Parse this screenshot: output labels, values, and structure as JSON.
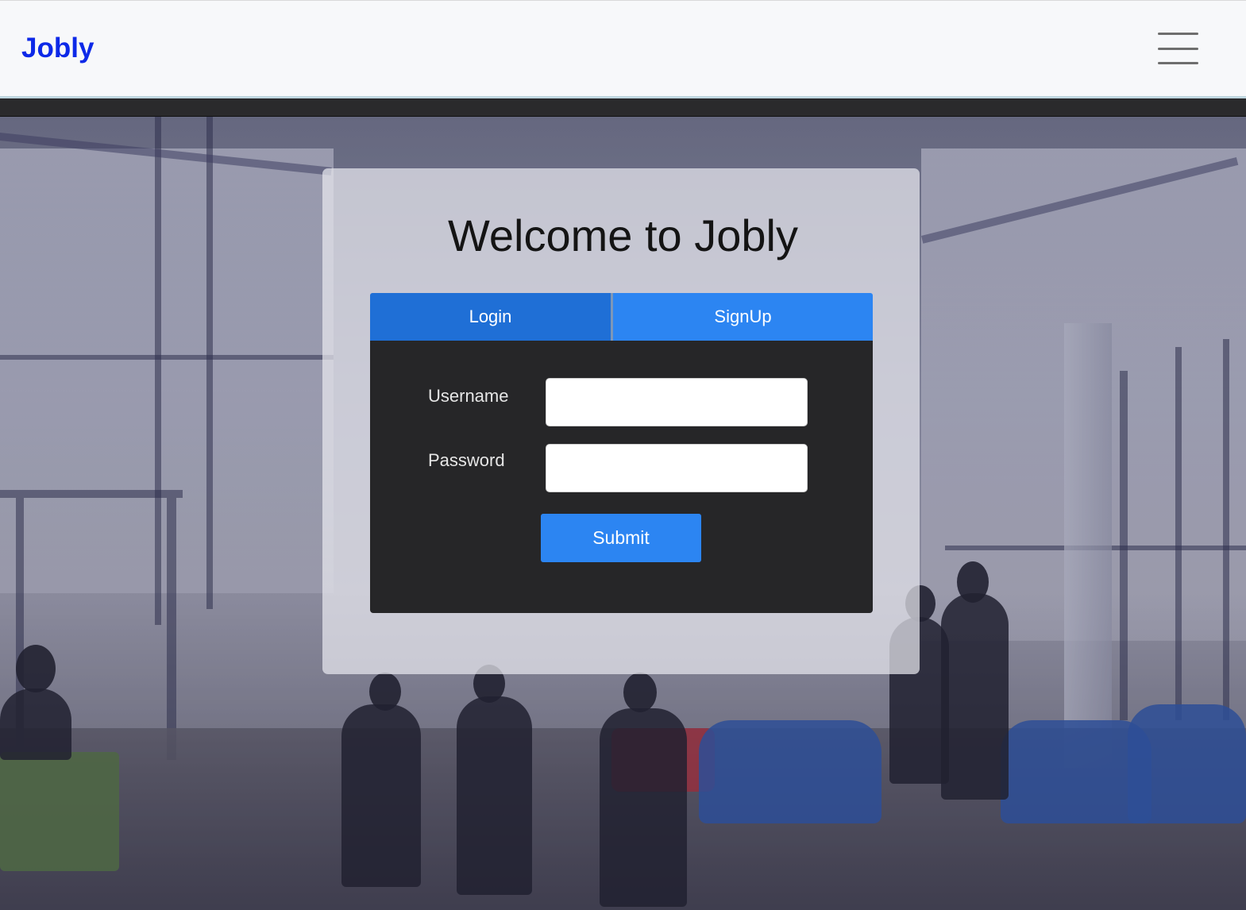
{
  "navbar": {
    "brand": "Jobly",
    "brand_color": "#0d29e8",
    "menu_icon": "hamburger-menu-icon"
  },
  "login_card": {
    "title": "Welcome to Jobly",
    "tabs": [
      {
        "label": "Login",
        "active": true
      },
      {
        "label": "SignUp",
        "active": false
      }
    ],
    "fields": {
      "username": {
        "label": "Username",
        "value": "",
        "placeholder": ""
      },
      "password": {
        "label": "Password",
        "value": "",
        "placeholder": ""
      }
    },
    "submit_label": "Submit",
    "accent_color": "#2c85f2",
    "active_tab_color": "#1f6fd6"
  }
}
